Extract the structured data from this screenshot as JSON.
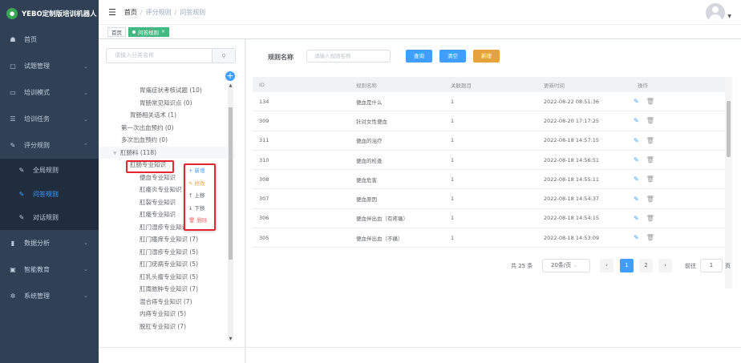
{
  "app": {
    "title": "YEBO定制版培训机器人"
  },
  "sidebar": {
    "items": [
      {
        "label": "首页",
        "icon": "dashboard-icon"
      },
      {
        "label": "试题管理",
        "icon": "book-icon"
      },
      {
        "label": "培训模式",
        "icon": "monitor-icon"
      },
      {
        "label": "培训任务",
        "icon": "list-icon"
      },
      {
        "label": "评分规则",
        "icon": "edit-icon"
      },
      {
        "label": "全局规则",
        "icon": "edit-icon"
      },
      {
        "label": "问答规则",
        "icon": "edit-icon"
      },
      {
        "label": "对话规则",
        "icon": "edit-icon"
      },
      {
        "label": "数据分析",
        "icon": "chart-icon"
      },
      {
        "label": "智能教育",
        "icon": "screen-icon"
      },
      {
        "label": "系统管理",
        "icon": "gear-icon"
      }
    ]
  },
  "breadcrumb": [
    "首页",
    "评分规则",
    "问答规则"
  ],
  "tags": [
    "首页",
    "问答规则"
  ],
  "tree": {
    "search_placeholder": "请输入分类名称",
    "nodes": [
      "胃痛症状考核试题 (10)",
      "胃肠常见知识点 (0)",
      "胃肠相关话术 (1)",
      "第一次出血预约 (0)",
      "多次出血预约 (0)",
      "肛肠科 (118)",
      "肛肠专业知识",
      "便血专业知识",
      "肛瘘炎专业知识",
      "肛裂专业知识",
      "肛瘘专业知识",
      "肛门湿疹专业知识",
      "肛门瘙痒专业知识 (7)",
      "肛门湿疹专业知识 (5)",
      "肛门疣病专业知识 (5)",
      "肛乳头瘤专业知识 (5)",
      "肛周脓肿专业知识 (7)",
      "混合痔专业知识 (7)",
      "内痔专业知识 (5)",
      "脱肛专业知识 (7)"
    ],
    "context_menu": [
      "+ 新增",
      "✎ 修改",
      "↑ 上移",
      "↓ 下移",
      "🗑 删除"
    ]
  },
  "query": {
    "label": "规则名称",
    "placeholder": "请输入规则名称",
    "search_btn": "查询",
    "reset_btn": "清空",
    "add_btn": "新增"
  },
  "table": {
    "headers": [
      "ID",
      "规则名称",
      "关联题目",
      "更新时间",
      "操作"
    ],
    "rows": [
      [
        "134",
        "便血是什么",
        "1",
        "2022-08-22 08:51:36"
      ],
      [
        "309",
        "针对女性便血",
        "1",
        "2022-08-20 17:17:25"
      ],
      [
        "311",
        "便血的治疗",
        "1",
        "2022-08-18 14:57:15"
      ],
      [
        "310",
        "便血的检查",
        "1",
        "2022-08-18 14:56:51"
      ],
      [
        "308",
        "便血危害",
        "1",
        "2022-08-18 14:55:11"
      ],
      [
        "307",
        "便血原因",
        "1",
        "2022-08-18 14:54:37"
      ],
      [
        "306",
        "便血伴出血（有疼痛）",
        "1",
        "2022-08-18 14:54:15"
      ],
      [
        "305",
        "便血伴出血（不痛）",
        "1",
        "2022-08-18 14:53:09"
      ]
    ]
  },
  "pagination": {
    "total": "共 25 条",
    "size": "20条/页",
    "page1": "1",
    "page2": "2",
    "goto": "前往",
    "goto_value": "1",
    "page_unit": "页"
  },
  "colors": {
    "primary": "#409eff",
    "warning": "#e6a23c",
    "sidebar": "#304156",
    "tag_active": "#42b983",
    "highlight": "#e6262e"
  }
}
